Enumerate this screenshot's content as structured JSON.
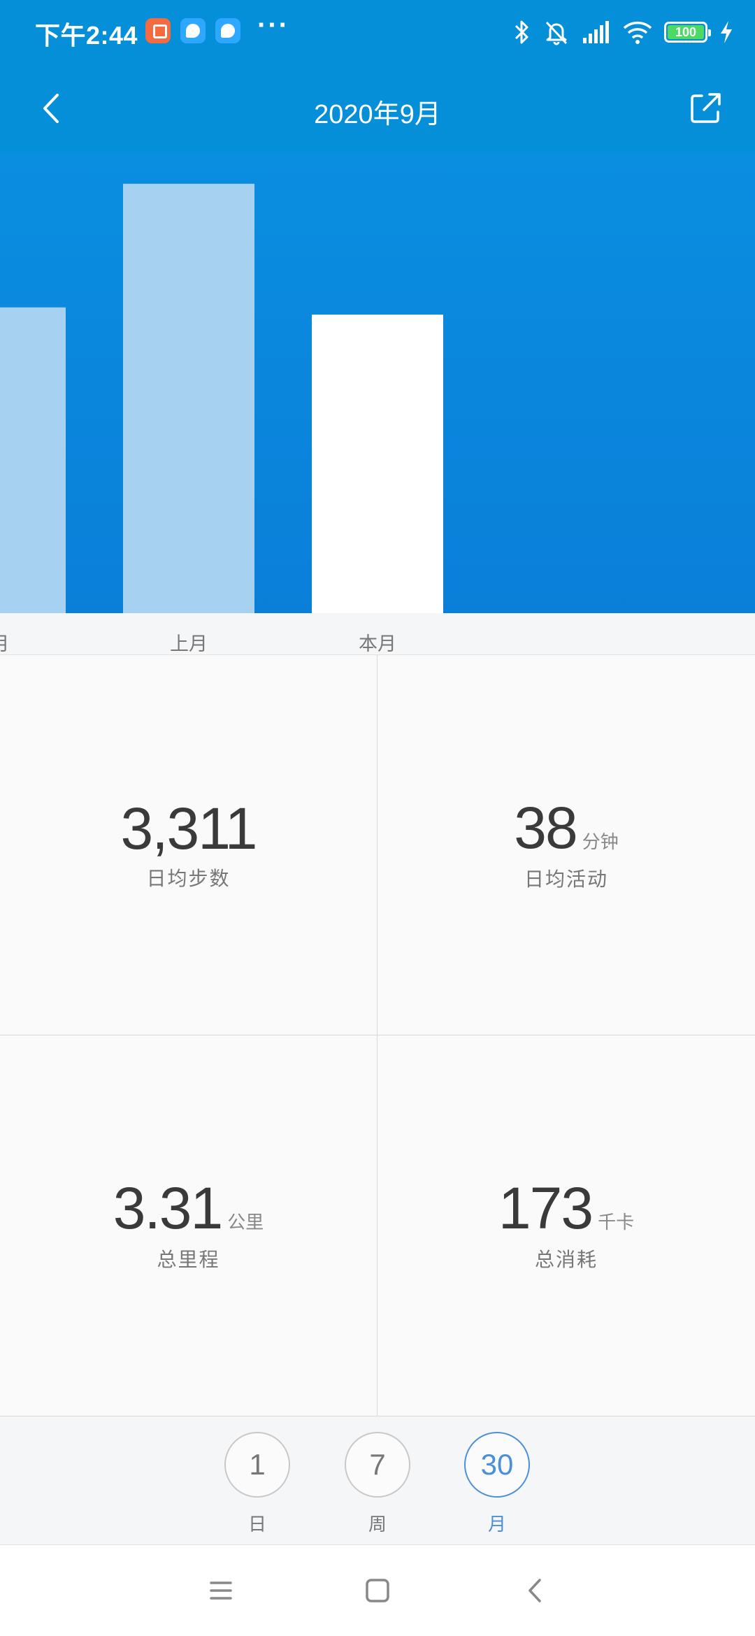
{
  "status_bar": {
    "time": "下午2:44",
    "more": "···",
    "battery": "100",
    "icons": [
      "mi-mall-icon",
      "bubble-app-icon",
      "bubble-app-icon",
      "bluetooth-icon",
      "mute-icon",
      "signal-icon",
      "wifi-icon",
      "battery-icon",
      "charging-icon"
    ]
  },
  "header": {
    "title": "2020年9月",
    "back_icon": "chevron-left-icon",
    "share_icon": "share-icon"
  },
  "chart_data": {
    "type": "bar",
    "categories": [
      "月",
      "上月",
      "本月"
    ],
    "values": [
      2975,
      4178,
      2905
    ],
    "selected_index": 2,
    "colors": {
      "normal": "#a6d1f0",
      "selected": "#ffffff",
      "background": "#0a86dc"
    }
  },
  "stats": [
    {
      "value": "3,311",
      "unit": "",
      "label": "日均步数"
    },
    {
      "value": "38",
      "unit": "分钟",
      "label": "日均活动"
    },
    {
      "value": "3.31",
      "unit": "公里",
      "label": "总里程"
    },
    {
      "value": "173",
      "unit": "千卡",
      "label": "总消耗"
    }
  ],
  "period_options": [
    {
      "number": "1",
      "label": "日",
      "active": false
    },
    {
      "number": "7",
      "label": "周",
      "active": false
    },
    {
      "number": "30",
      "label": "月",
      "active": true
    }
  ],
  "colors": {
    "primary": "#058fd8",
    "accent": "#4a8fd8"
  },
  "nav_bar": {
    "icons": [
      "menu-icon",
      "home-icon",
      "back-icon"
    ]
  }
}
